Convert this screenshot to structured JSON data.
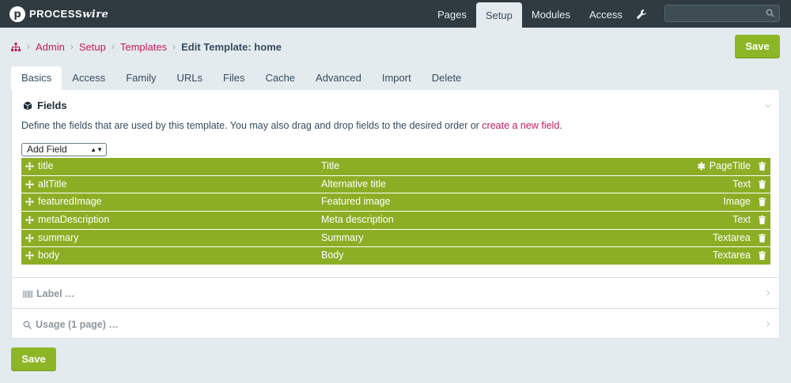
{
  "app": {
    "logo_text": "PROCESS",
    "logo_text_italic": "wire"
  },
  "topnav": [
    {
      "label": "Pages",
      "active": false
    },
    {
      "label": "Setup",
      "active": true
    },
    {
      "label": "Modules",
      "active": false
    },
    {
      "label": "Access",
      "active": false
    }
  ],
  "search": {
    "placeholder": ""
  },
  "breadcrumb": {
    "items": [
      "Admin",
      "Setup",
      "Templates"
    ],
    "current": "Edit Template: home"
  },
  "save_label": "Save",
  "tabs": [
    "Basics",
    "Access",
    "Family",
    "URLs",
    "Files",
    "Cache",
    "Advanced",
    "Import",
    "Delete"
  ],
  "fields_section": {
    "title": "Fields",
    "description": "Define the fields that are used by this template. You may also drag and drop fields to the desired order or ",
    "link": "create a new field",
    "period": ".",
    "add_field": "Add Field",
    "rows": [
      {
        "name": "title",
        "label": "Title",
        "type": "PageTitle",
        "required": true
      },
      {
        "name": "altTitle",
        "label": "Alternative title",
        "type": "Text",
        "required": false
      },
      {
        "name": "featuredImage",
        "label": "Featured image",
        "type": "Image",
        "required": false
      },
      {
        "name": "metaDescription",
        "label": "Meta description",
        "type": "Text",
        "required": false
      },
      {
        "name": "summary",
        "label": "Summary",
        "type": "Textarea",
        "required": false
      },
      {
        "name": "body",
        "label": "Body",
        "type": "Textarea",
        "required": false
      }
    ]
  },
  "label_section": {
    "title": "Label …"
  },
  "usage_section": {
    "title": "Usage (1 page) …"
  },
  "colors": {
    "accent": "#8cb626",
    "row": "#8cae25",
    "link": "#c01b61",
    "topbar": "#2f3b41"
  },
  "icons": [
    "search-icon",
    "wrench-icon",
    "sitemap-icon",
    "cube-icon",
    "move-icon",
    "trash-icon",
    "asterisk-icon",
    "barcode-icon",
    "chevron-icon"
  ]
}
